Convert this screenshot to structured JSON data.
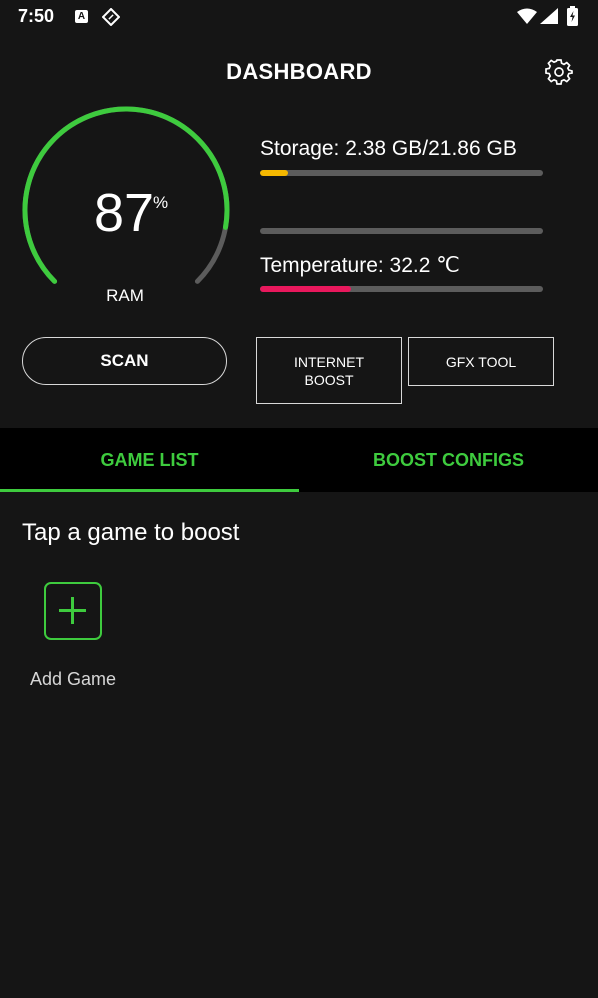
{
  "status_bar": {
    "time": "7:50",
    "notification_letter": "A",
    "icons": [
      "a-notification-icon",
      "tag-icon",
      "wifi-icon",
      "cellular-signal-icon",
      "battery-icon"
    ]
  },
  "header": {
    "title": "DASHBOARD",
    "settings_icon": "gear-icon"
  },
  "ram": {
    "value": "87",
    "unit": "%",
    "label": "RAM",
    "percent": 87
  },
  "storage": {
    "label": "Storage: 2.38 GB/21.86 GB",
    "fraction": 0.1,
    "color": "#f5b800"
  },
  "middle_bar": {
    "fraction": 0
  },
  "temperature": {
    "label": "Temperature: 32.2 ℃",
    "fraction": 0.32,
    "color": "#e8185c"
  },
  "buttons": {
    "scan": "SCAN",
    "internet_boost_line1": "INTERNET",
    "internet_boost_line2": "BOOST",
    "gfx_tool": "GFX TOOL"
  },
  "tabs": [
    {
      "label": "GAME LIST",
      "selected": true
    },
    {
      "label": "BOOST CONFIGS",
      "selected": false
    }
  ],
  "game_list": {
    "hint": "Tap a game to boost",
    "add_game_label": "Add Game",
    "add_icon": "plus-icon"
  },
  "colors": {
    "accent": "#3ecb3e",
    "background": "#151515",
    "tab_background": "#000000",
    "track": "#5c5c5c"
  }
}
